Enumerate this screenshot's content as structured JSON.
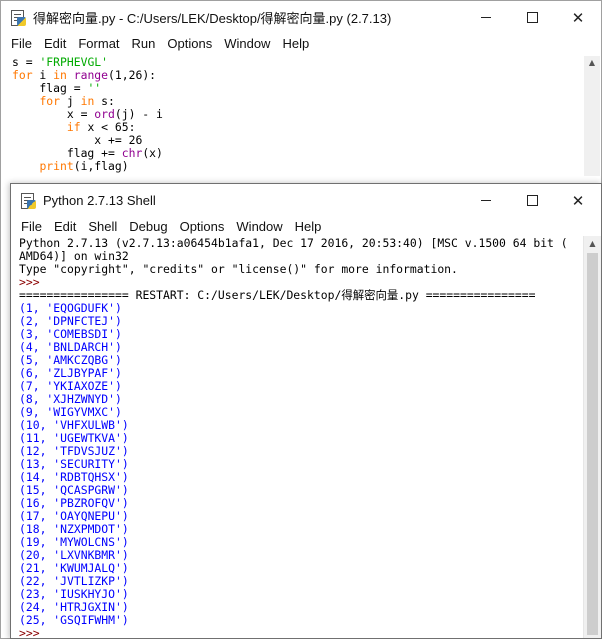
{
  "editor": {
    "title": "得解密向量.py - C:/Users/LEK/Desktop/得解密向量.py (2.7.13)",
    "menu": [
      "File",
      "Edit",
      "Format",
      "Run",
      "Options",
      "Window",
      "Help"
    ],
    "code": [
      {
        "p": [
          [
            "dk",
            "s = "
          ],
          [
            "st",
            "'FRPHEVGL'"
          ]
        ]
      },
      {
        "p": [
          [
            "kw",
            "for"
          ],
          [
            "dk",
            " i "
          ],
          [
            "kw",
            "in"
          ],
          [
            "dk",
            " "
          ],
          [
            "bi",
            "range"
          ],
          [
            "dk",
            "(1,26):"
          ]
        ]
      },
      {
        "p": [
          [
            "dk",
            "    flag = "
          ],
          [
            "st",
            "''"
          ]
        ]
      },
      {
        "p": [
          [
            "dk",
            "    "
          ],
          [
            "kw",
            "for"
          ],
          [
            "dk",
            " j "
          ],
          [
            "kw",
            "in"
          ],
          [
            "dk",
            " s:"
          ]
        ]
      },
      {
        "p": [
          [
            "dk",
            "        x = "
          ],
          [
            "bi",
            "ord"
          ],
          [
            "dk",
            "(j) - i"
          ]
        ]
      },
      {
        "p": [
          [
            "dk",
            "        "
          ],
          [
            "kw",
            "if"
          ],
          [
            "dk",
            " x < 65:"
          ]
        ]
      },
      {
        "p": [
          [
            "dk",
            "            x += 26"
          ]
        ]
      },
      {
        "p": [
          [
            "dk",
            "        flag += "
          ],
          [
            "bi",
            "chr"
          ],
          [
            "dk",
            "(x)"
          ]
        ]
      },
      {
        "p": [
          [
            "dk",
            "    "
          ],
          [
            "kw",
            "print"
          ],
          [
            "dk",
            "(i,flag)"
          ]
        ]
      }
    ]
  },
  "shell": {
    "title": "Python 2.7.13 Shell",
    "menu": [
      "File",
      "Edit",
      "Shell",
      "Debug",
      "Options",
      "Window",
      "Help"
    ],
    "banner": [
      "Python 2.7.13 (v2.7.13:a06454b1afa1, Dec 17 2016, 20:53:40) [MSC v.1500 64 bit (",
      "AMD64)] on win32",
      "Type \"copyright\", \"credits\" or \"license()\" for more information."
    ],
    "prompt": ">>> ",
    "restart": "================ RESTART: C:/Users/LEK/Desktop/得解密向量.py ================",
    "output": [
      "(1, 'EQOGDUFK')",
      "(2, 'DPNFCTEJ')",
      "(3, 'COMEBSDI')",
      "(4, 'BNLDARCH')",
      "(5, 'AMKCZQBG')",
      "(6, 'ZLJBYPAF')",
      "(7, 'YKIAXOZE')",
      "(8, 'XJHZWNYD')",
      "(9, 'WIGYVMXC')",
      "(10, 'VHFXULWB')",
      "(11, 'UGEWTKVA')",
      "(12, 'TFDVSJUZ')",
      "(13, 'SECURITY')",
      "(14, 'RDBTQHSX')",
      "(15, 'QCASPGRW')",
      "(16, 'PBZROFQV')",
      "(17, 'OAYQNEPU')",
      "(18, 'NZXPMDOT')",
      "(19, 'MYWOLCNS')",
      "(20, 'LXVNKBMR')",
      "(21, 'KWUMJALQ')",
      "(22, 'JVTLIZKP')",
      "(23, 'IUSKHYJO')",
      "(24, 'HTRJGXIN')",
      "(25, 'GSQIFWHM')"
    ]
  }
}
